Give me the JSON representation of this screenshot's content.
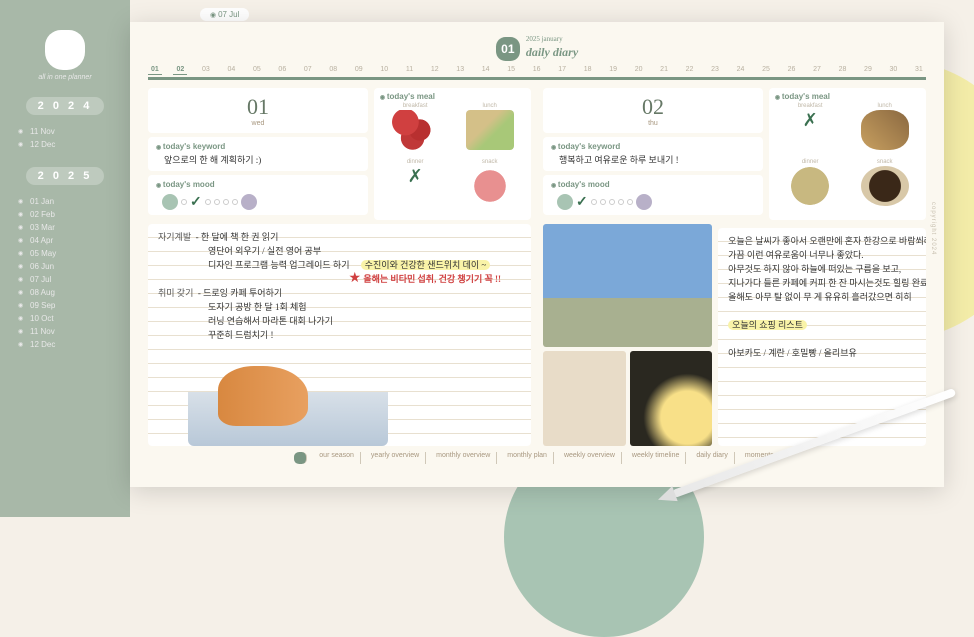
{
  "top_tag": "07 Jul",
  "sidebar": {
    "label": "all in one planner",
    "years": [
      {
        "year": "2024",
        "months": [
          "11 Nov",
          "12 Dec"
        ]
      },
      {
        "year": "2025",
        "months": [
          "01 Jan",
          "02 Feb",
          "03 Mar",
          "04 Apr",
          "05 May",
          "06 Jun",
          "07 Jul",
          "08 Aug",
          "09 Sep",
          "10 Oct",
          "11 Nov",
          "12 Dec"
        ]
      }
    ]
  },
  "header": {
    "num": "01",
    "sub": "2025 january",
    "main": "daily diary"
  },
  "dates": [
    "01",
    "02",
    "03",
    "04",
    "05",
    "06",
    "07",
    "08",
    "09",
    "10",
    "11",
    "12",
    "13",
    "14",
    "15",
    "16",
    "17",
    "18",
    "19",
    "20",
    "21",
    "22",
    "23",
    "24",
    "25",
    "26",
    "27",
    "28",
    "29",
    "30",
    "31"
  ],
  "active_dates": [
    "01",
    "02"
  ],
  "days": [
    {
      "num": "01",
      "dow": "wed",
      "keyword_title": "today's keyword",
      "keyword": "앞으로의 한 해 계획하기 :)",
      "mood_title": "today's mood",
      "meal_title": "today's meal",
      "meal_labels": [
        "breakfast",
        "lunch",
        "dinner",
        "snack"
      ],
      "notes": {
        "cat1": "자기계발",
        "lines1": [
          "- 한 달에 책 한 권 읽기",
          "영단어 외우기 / 실전 영어 공부",
          "디자인 프로그램 능력 업그레이드 하기"
        ],
        "hl1": "수진이와 건강한 샌드위치 데이 ~",
        "star_line": "올해는 비타민 섭취, 건강 챙기기 꼭 !!",
        "cat2": "취미 갖기",
        "lines2": [
          "- 드로잉 카페 투어하기",
          "도자기 공방 한 달 1회 체험",
          "러닝 연습해서 마라톤 대회 나가기",
          "꾸준히 드럼치기 !"
        ]
      }
    },
    {
      "num": "02",
      "dow": "thu",
      "keyword_title": "today's keyword",
      "keyword": "행복하고 여유로운 하루 보내기 !",
      "mood_title": "today's mood",
      "meal_title": "today's meal",
      "meal_labels": [
        "breakfast",
        "lunch",
        "dinner",
        "snack"
      ],
      "notes": {
        "lines": [
          "오늘은 날씨가 좋아서 오랜만에 혼자 한강으로 바람쐬러 다녀왔다 ㅎㅎ",
          "가끔 이런 여유로움이 너무나 좋았다.",
          "아무것도 하지 않아     하늘에 떠있는 구름을 보고,",
          "지나가다 들른 카페에     커피 한 잔 마시는것도 힐링 완료 ..!",
          "올해도 아무 탈 없이 무         게 유유히 흘러갔으면 히히"
        ],
        "hl": "오늘의 쇼핑 리스트",
        "after": "아보카도 / 계란 / 호밀빵 / 올리브유"
      }
    }
  ],
  "footer": [
    "our season",
    "yearly overview",
    "monthly overview",
    "monthly plan",
    "weekly overview",
    "weekly timeline",
    "daily diary",
    "moments"
  ],
  "side_text": "copyright 2024"
}
